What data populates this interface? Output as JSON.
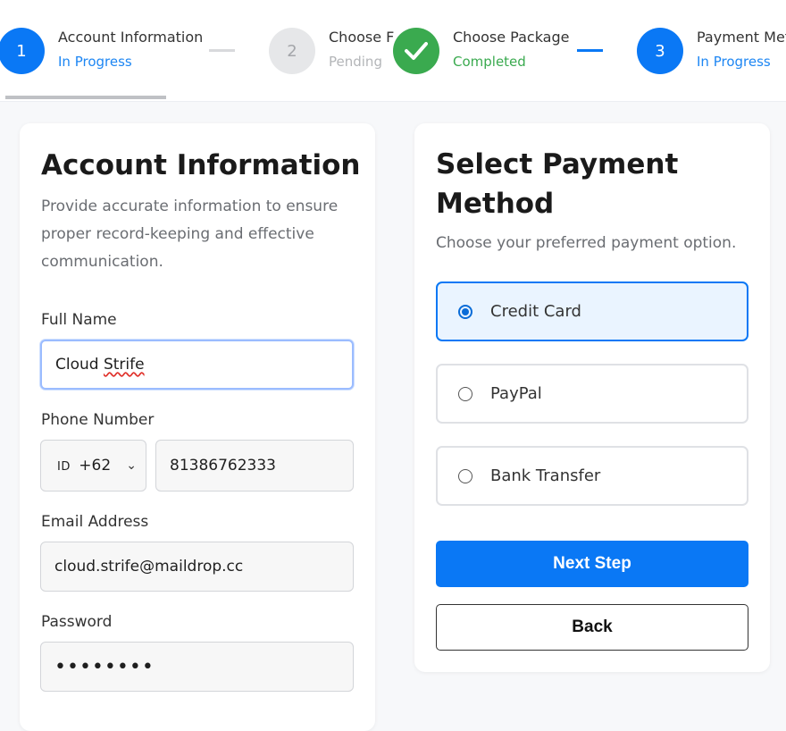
{
  "stepper": {
    "steps": [
      {
        "number": "1",
        "title": "Account Information",
        "status": "In Progress"
      },
      {
        "number": "2",
        "title": "Choose F",
        "status": "Pending"
      },
      {
        "number": "",
        "title": "Choose Package",
        "status": "Completed"
      },
      {
        "number": "3",
        "title": "Payment Met",
        "status": "In Progress"
      }
    ]
  },
  "account": {
    "title": "Account Information",
    "description": "Provide accurate information to ensure proper record-keeping and effective communication.",
    "full_name_label": "Full Name",
    "full_name_value": "Cloud Strife",
    "phone_label": "Phone Number",
    "country_flag": "ID",
    "country_code": "+62",
    "phone_value": "81386762333",
    "email_label": "Email Address",
    "email_value": "cloud.strife@maildrop.cc",
    "password_label": "Password",
    "password_value": "••••••••"
  },
  "payment": {
    "title": "Select Payment Method",
    "description": "Choose your preferred payment option.",
    "options": [
      {
        "label": "Credit Card",
        "selected": true
      },
      {
        "label": "PayPal",
        "selected": false
      },
      {
        "label": "Bank Transfer",
        "selected": false
      }
    ],
    "next_label": "Next Step",
    "back_label": "Back"
  },
  "colors": {
    "primary": "#0a78f5",
    "success": "#3aaa4f",
    "pending": "#b3b5b8"
  }
}
